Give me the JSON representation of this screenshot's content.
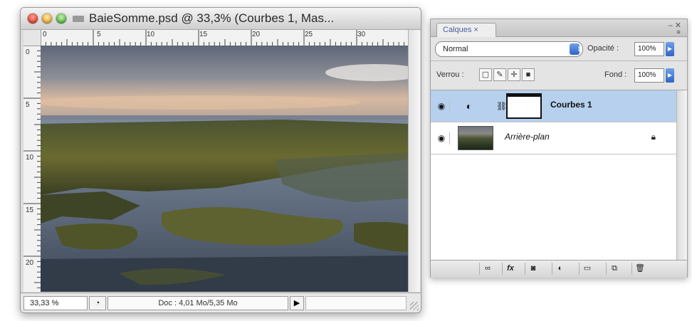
{
  "document": {
    "title": "BaieSomme.psd @ 33,3% (Courbes 1, Mas...",
    "ruler_h": [
      "0",
      "5",
      "10",
      "15",
      "20",
      "25",
      "30"
    ],
    "ruler_v": [
      "0",
      "5",
      "10",
      "15",
      "20"
    ],
    "zoom": "33,33 %",
    "doc_info": "Doc : 4,01 Mo/5,35 Mo"
  },
  "layers_panel": {
    "tab_label": "Calques",
    "tab_close": "×",
    "blend_mode": "Normal",
    "opacity_label": "Opacité :",
    "opacity_value": "100%",
    "lock_label": "Verrou :",
    "fill_label": "Fond :",
    "fill_value": "100%",
    "layers": [
      {
        "name": "Courbes 1",
        "selected": true
      },
      {
        "name": "Arrière-plan",
        "selected": false
      }
    ],
    "bottom_icons": [
      "link-icon",
      "fx-icon",
      "mask-icon",
      "adjustment-icon",
      "folder-icon",
      "new-layer-icon",
      "trash-icon"
    ]
  }
}
